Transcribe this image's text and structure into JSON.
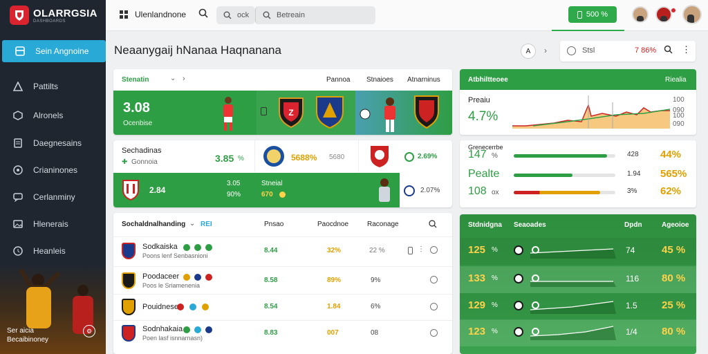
{
  "brand": {
    "title": "OLARRGSIA",
    "subtitle": "DASHBOARDS"
  },
  "sidebar": {
    "items": [
      {
        "label": "Sein Angnoine",
        "icon": "layout-icon",
        "active": true
      },
      {
        "label": "Pattilts",
        "icon": "warning-icon"
      },
      {
        "label": "Alronels",
        "icon": "cube-icon"
      },
      {
        "label": "Daegnesains",
        "icon": "document-icon"
      },
      {
        "label": "Crianinones",
        "icon": "target-icon"
      },
      {
        "label": "Cerlanminy",
        "icon": "chat-icon"
      },
      {
        "label": "Hlenerais",
        "icon": "image-icon"
      },
      {
        "label": "Heanleis",
        "icon": "clock-icon"
      }
    ],
    "footer": {
      "line1": "Ser aicia",
      "line2": "Becaibinoney"
    }
  },
  "topbar": {
    "app_name": "Ulenlandnone",
    "search1": "ock",
    "search2": "Betreain",
    "status_pill": "500 %",
    "accent": "#2eaa4a"
  },
  "page": {
    "title": "Neaanygaij hNanaa Haqnanana",
    "filter_label": "Stsl",
    "filter_value": "7 86%"
  },
  "card1": {
    "header": {
      "left": "Stenatin",
      "cols": [
        "Pannoa",
        "Stnaioes",
        "Atnarninus"
      ]
    },
    "value": "3.08",
    "caption": "Ocenbise"
  },
  "card2": {
    "title": "Sechadinas",
    "subtitle": "Gonnoia",
    "pct": "3.85",
    "pct_unit": "%",
    "v1": "5688%",
    "v2": "5680",
    "v3": "2.69%",
    "bottom_value": "2.84",
    "bottom_a": "3.05",
    "bottom_b": "90%",
    "bottom_label": "Stneial",
    "bottom_c": "670",
    "bottom_d": "2.07%"
  },
  "table": {
    "headers": [
      "Sochaldnalhanding",
      "Pnsao",
      "Paocdnoe",
      "Raconage"
    ],
    "header_tag": "REI",
    "rows": [
      {
        "name": "Sodkaiska",
        "sub": "Poons lenf Senbasnioni",
        "a": "8.44",
        "b": "32%",
        "c": "22 %"
      },
      {
        "name": "Poodaceer",
        "sub": "Poos le Sriamenenia",
        "a": "8.58",
        "b": "89%",
        "c": "9%"
      },
      {
        "name": "Pouidnese",
        "sub": "",
        "a": "8.54",
        "b": "1.84",
        "c": "6%"
      },
      {
        "name": "Sodnhakaia",
        "sub": "Poen lasf isnnarnasn)",
        "a": "8.83",
        "b": "007",
        "c": "08"
      }
    ]
  },
  "rightTop": {
    "header": {
      "left": "Atbhiltteoee",
      "right": "Riealia"
    },
    "label": "Preaiu",
    "value": "4.7%",
    "axis": [
      "100",
      "090",
      "100",
      "090"
    ]
  },
  "rightMid": {
    "label": "Grenecerrbe",
    "rows": [
      {
        "v": "147",
        "u": "%",
        "n": "428",
        "p": "44%",
        "fill": 0.92,
        "color": "#2e9e44"
      },
      {
        "v": "Pealte",
        "u": "",
        "n": "1.94",
        "p": "565%",
        "fill": 0.58,
        "color": "#2e9e44"
      },
      {
        "v": "108",
        "u": "ox",
        "n": "3%",
        "p": "62%",
        "fill": 0.85,
        "color": "#e0a100"
      }
    ]
  },
  "rightBottom": {
    "headers": [
      "Stdnidgna",
      "Seaoades",
      "Dpdn",
      "Ageoioe"
    ],
    "rows": [
      {
        "v": "125",
        "n": "74",
        "p": "45 %"
      },
      {
        "v": "133",
        "n": "116",
        "p": "80 %"
      },
      {
        "v": "129",
        "n": "1.5",
        "p": "25 %"
      },
      {
        "v": "123",
        "n": "1/4",
        "p": "80 %"
      }
    ]
  }
}
